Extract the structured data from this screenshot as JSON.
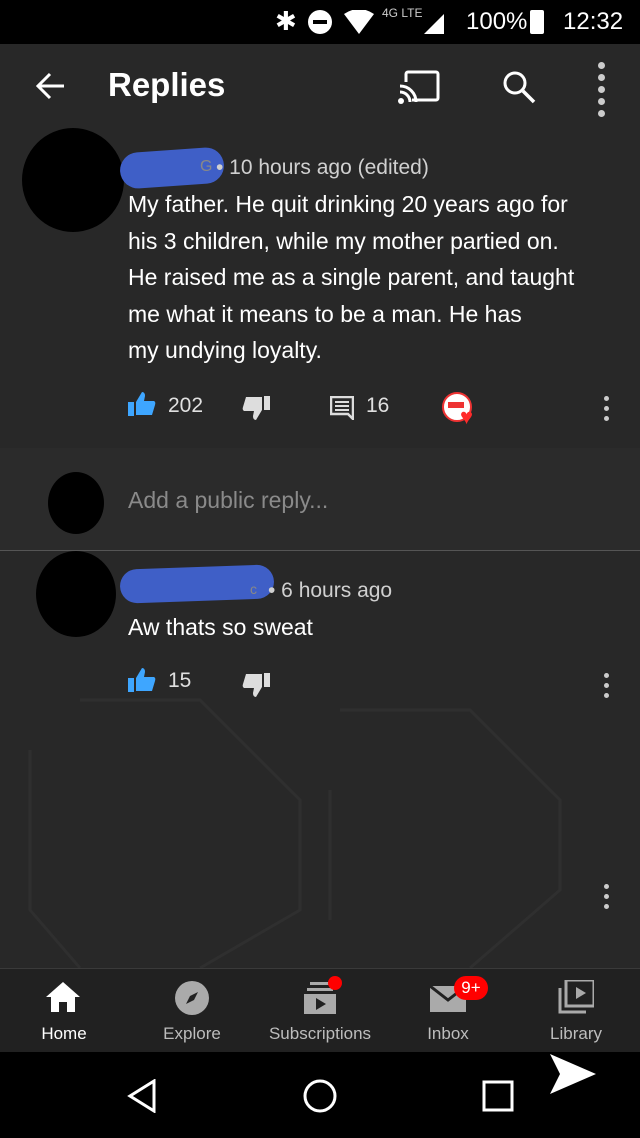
{
  "status_bar": {
    "network": "4G LTE",
    "battery": "100%",
    "time": "12:32"
  },
  "app_bar": {
    "title": "Replies",
    "icons": [
      "back-arrow-icon",
      "cast-icon",
      "search-icon",
      "more-vert-icon"
    ]
  },
  "comment": {
    "author_visible": "G",
    "meta": "• 10 hours ago (edited)",
    "text_lines": [
      "My father. He quit drinking 20 years ago for",
      "his 3 children, while my mother partied on.",
      "He raised me as a single parent, and taught",
      "me what it means to be a man. He has",
      "my undying loyalty."
    ],
    "likes": "202",
    "replies": "16"
  },
  "reply_input": {
    "placeholder": "Add a public reply..."
  },
  "reply": {
    "author_visible": "c",
    "meta": "• 6 hours ago",
    "text": "Aw thats so sweat",
    "likes": "15"
  },
  "bottom_nav": {
    "items": [
      {
        "label": "Home",
        "icon": "home-icon"
      },
      {
        "label": "Explore",
        "icon": "compass-icon"
      },
      {
        "label": "Subscriptions",
        "icon": "subscriptions-icon"
      },
      {
        "label": "Inbox",
        "icon": "inbox-icon",
        "badge": "9+"
      },
      {
        "label": "Library",
        "icon": "library-icon"
      }
    ]
  },
  "colors": {
    "accent_blue": "#3ea6ff",
    "badge_red": "#ff0000",
    "redaction_blue": "#3f5fc7"
  }
}
